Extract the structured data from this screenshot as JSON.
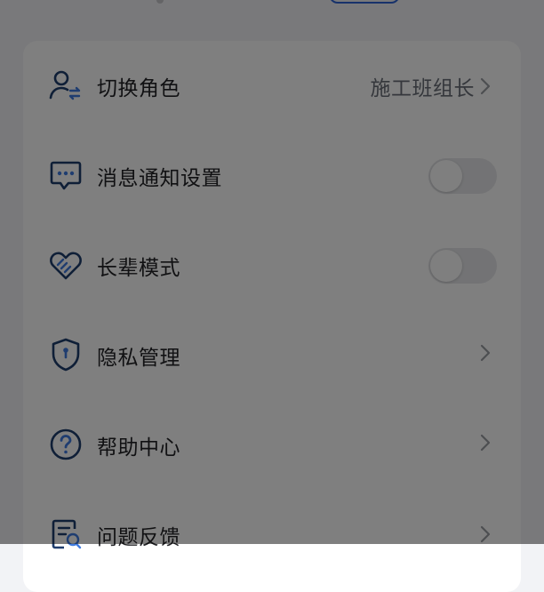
{
  "colors": {
    "accent": "#2f64d7",
    "icon_stroke": "#1f3e6e",
    "icon_accent": "#3f7be0",
    "text_primary": "#222326",
    "text_secondary": "#6a6f78",
    "toggle_off": "#e6e7ea",
    "overlay": "rgba(0,0,0,0.5)"
  },
  "settings": {
    "items": [
      {
        "icon": "switch-role-icon",
        "label": "切换角色",
        "value": "施工班组长",
        "control": "chevron"
      },
      {
        "icon": "message-icon",
        "label": "消息通知设置",
        "control": "toggle",
        "checked": false
      },
      {
        "icon": "heart-hands-icon",
        "label": "长辈模式",
        "control": "toggle",
        "checked": false
      },
      {
        "icon": "shield-icon",
        "label": "隐私管理",
        "control": "chevron"
      },
      {
        "icon": "help-icon",
        "label": "帮助中心",
        "control": "chevron"
      },
      {
        "icon": "feedback-icon",
        "label": "问题反馈",
        "control": "chevron"
      }
    ]
  }
}
